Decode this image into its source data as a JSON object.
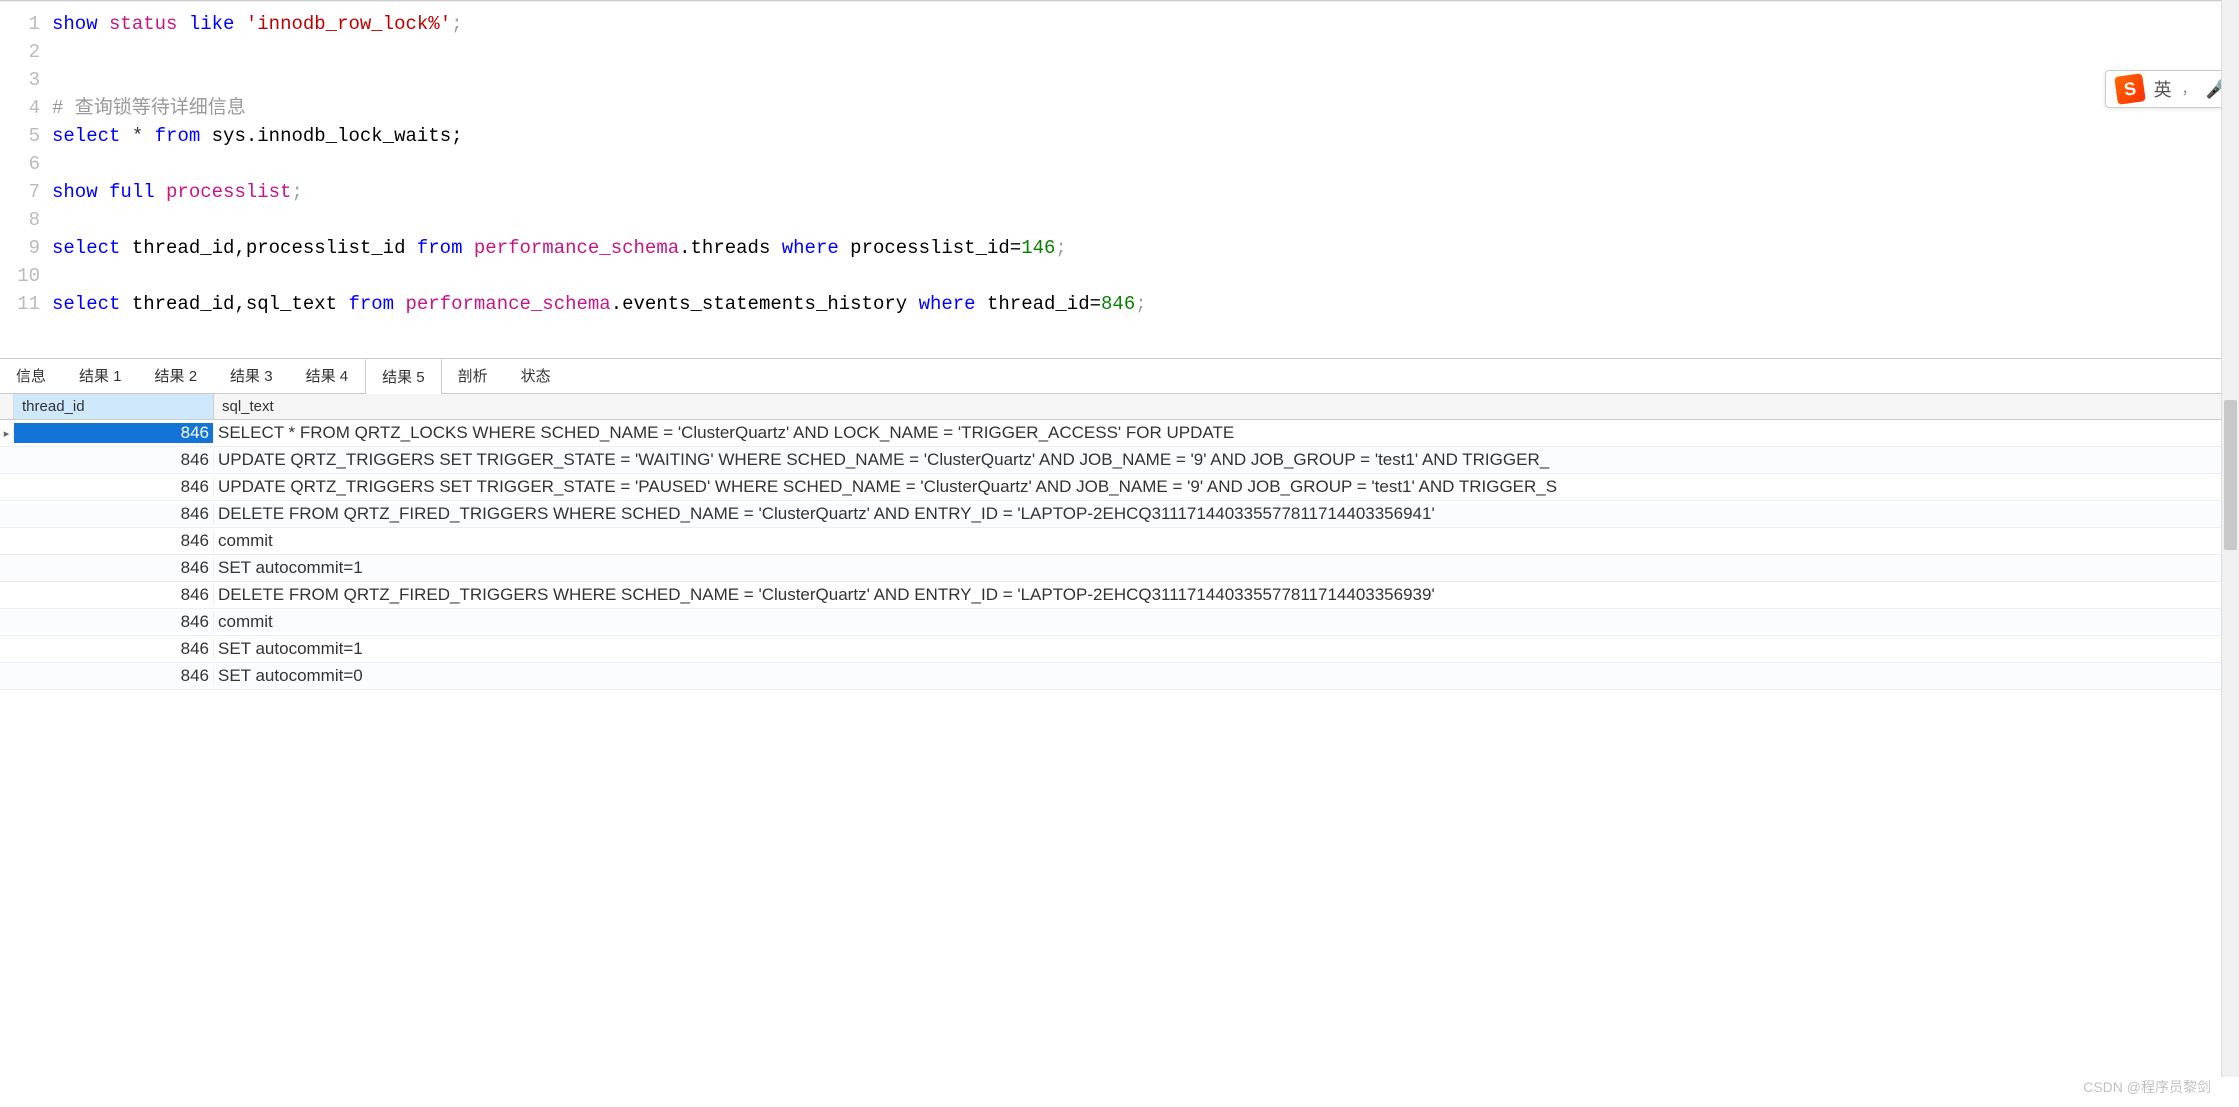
{
  "editor": {
    "lines": [
      {
        "n": "1",
        "tokens": [
          {
            "t": "show",
            "c": "kw"
          },
          {
            "t": " "
          },
          {
            "t": "status",
            "c": "pink"
          },
          {
            "t": " "
          },
          {
            "t": "like",
            "c": "kw"
          },
          {
            "t": " "
          },
          {
            "t": "'innodb_row_lock%'",
            "c": "str"
          },
          {
            "t": ";",
            "c": "punct"
          }
        ]
      },
      {
        "n": "2",
        "tokens": []
      },
      {
        "n": "3",
        "tokens": []
      },
      {
        "n": "4",
        "tokens": [
          {
            "t": "# 查询锁等待详细信息",
            "c": "comment"
          }
        ]
      },
      {
        "n": "5",
        "tokens": [
          {
            "t": "select",
            "c": "kw"
          },
          {
            "t": " * "
          },
          {
            "t": "from",
            "c": "kw"
          },
          {
            "t": " sys.innodb_lock_waits;",
            "c": "ident"
          }
        ]
      },
      {
        "n": "6",
        "tokens": []
      },
      {
        "n": "7",
        "tokens": [
          {
            "t": "show",
            "c": "kw"
          },
          {
            "t": " "
          },
          {
            "t": "full",
            "c": "kw"
          },
          {
            "t": " "
          },
          {
            "t": "processlist",
            "c": "pink"
          },
          {
            "t": ";",
            "c": "punct"
          }
        ]
      },
      {
        "n": "8",
        "tokens": []
      },
      {
        "n": "9",
        "tokens": [
          {
            "t": "select",
            "c": "kw"
          },
          {
            "t": " thread_id,processlist_id ",
            "c": "ident"
          },
          {
            "t": "from",
            "c": "kw"
          },
          {
            "t": " performance_schema",
            "c": "pink"
          },
          {
            "t": ".threads ",
            "c": "ident"
          },
          {
            "t": "where",
            "c": "kw"
          },
          {
            "t": " processlist_id=",
            "c": "ident"
          },
          {
            "t": "146",
            "c": "num"
          },
          {
            "t": ";",
            "c": "punct"
          }
        ]
      },
      {
        "n": "10",
        "tokens": []
      },
      {
        "n": "11",
        "tokens": [
          {
            "t": "select",
            "c": "kw"
          },
          {
            "t": " thread_id,sql_text ",
            "c": "ident"
          },
          {
            "t": "from",
            "c": "kw"
          },
          {
            "t": " performance_schema",
            "c": "pink"
          },
          {
            "t": ".events_statements_history ",
            "c": "ident"
          },
          {
            "t": "where",
            "c": "kw"
          },
          {
            "t": " thread_id=",
            "c": "ident"
          },
          {
            "t": "846",
            "c": "num"
          },
          {
            "t": ";",
            "c": "punct"
          }
        ]
      }
    ]
  },
  "tabs": {
    "items": [
      "信息",
      "结果 1",
      "结果 2",
      "结果 3",
      "结果 4",
      "结果 5",
      "剖析",
      "状态"
    ],
    "active_index": 5
  },
  "grid": {
    "columns": [
      "thread_id",
      "sql_text"
    ],
    "rows": [
      {
        "marker": "▸",
        "selected": true,
        "thread_id": "846",
        "sql_text": "SELECT * FROM QRTZ_LOCKS WHERE SCHED_NAME = 'ClusterQuartz' AND LOCK_NAME = 'TRIGGER_ACCESS' FOR UPDATE"
      },
      {
        "marker": "",
        "thread_id": "846",
        "sql_text": "UPDATE QRTZ_TRIGGERS SET TRIGGER_STATE = 'WAITING' WHERE SCHED_NAME = 'ClusterQuartz' AND JOB_NAME = '9' AND JOB_GROUP = 'test1' AND TRIGGER_"
      },
      {
        "marker": "",
        "thread_id": "846",
        "sql_text": "UPDATE QRTZ_TRIGGERS SET TRIGGER_STATE = 'PAUSED' WHERE SCHED_NAME = 'ClusterQuartz' AND JOB_NAME = '9' AND JOB_GROUP = 'test1' AND TRIGGER_S"
      },
      {
        "marker": "",
        "thread_id": "846",
        "sql_text": "DELETE FROM QRTZ_FIRED_TRIGGERS WHERE SCHED_NAME = 'ClusterQuartz' AND ENTRY_ID = 'LAPTOP-2EHCQ311171440335577811714403356941'"
      },
      {
        "marker": "",
        "thread_id": "846",
        "sql_text": "commit"
      },
      {
        "marker": "",
        "thread_id": "846",
        "sql_text": "SET autocommit=1"
      },
      {
        "marker": "",
        "thread_id": "846",
        "sql_text": "DELETE FROM QRTZ_FIRED_TRIGGERS WHERE SCHED_NAME = 'ClusterQuartz' AND ENTRY_ID = 'LAPTOP-2EHCQ311171440335577811714403356939'"
      },
      {
        "marker": "",
        "thread_id": "846",
        "sql_text": "commit"
      },
      {
        "marker": "",
        "thread_id": "846",
        "sql_text": "SET autocommit=1"
      },
      {
        "marker": "",
        "thread_id": "846",
        "sql_text": "SET autocommit=0"
      }
    ]
  },
  "ime": {
    "logo": "S",
    "lang": "英",
    "sep": "，"
  },
  "watermark": "CSDN @程序员黎剑"
}
